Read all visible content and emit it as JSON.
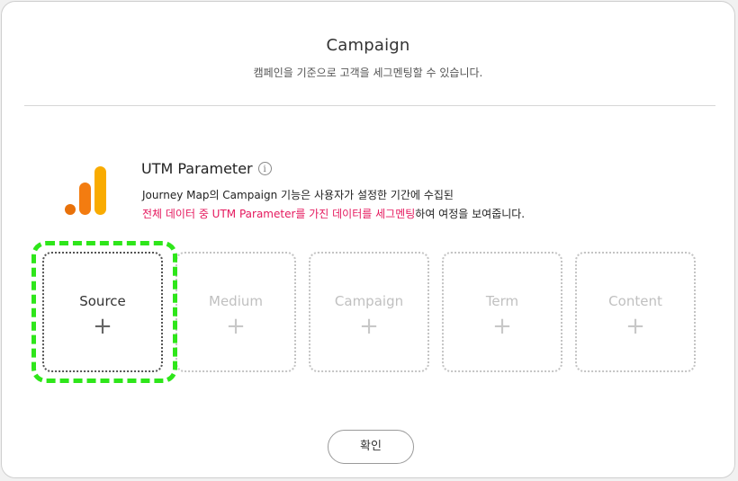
{
  "modal": {
    "title": "Campaign",
    "subtitle": "캠페인을 기준으로 고객을 세그멘팅할 수 있습니다."
  },
  "utm": {
    "title": "UTM Parameter",
    "info_icon": "i",
    "desc_line1": "Journey Map의 Campaign 기능은 사용자가 설정한 기간에 수집된",
    "desc_line2_highlight": "전체 데이터 중 UTM Parameter를 가진 데이터를 세그멘팅",
    "desc_line2_rest": "하여 여정을 보여줍니다."
  },
  "cards": [
    {
      "label": "Source",
      "plus": "+"
    },
    {
      "label": "Medium",
      "plus": "+"
    },
    {
      "label": "Campaign",
      "plus": "+"
    },
    {
      "label": "Term",
      "plus": "+"
    },
    {
      "label": "Content",
      "plus": "+"
    }
  ],
  "confirm_label": "확인",
  "colors": {
    "highlight_text": "#e5195e",
    "selection_outline": "#2ee61a",
    "logo_orange": "#f37c10",
    "logo_yellow": "#f9ab00"
  },
  "icons": {
    "logo": "google-analytics-logo-icon",
    "info": "info-icon",
    "add": "plus-icon"
  }
}
